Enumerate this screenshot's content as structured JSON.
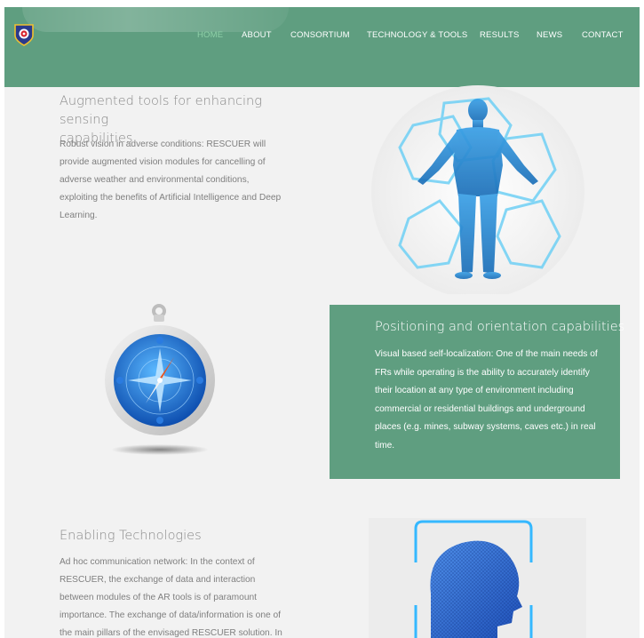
{
  "nav": {
    "items": [
      {
        "label": "HOME",
        "active": true
      },
      {
        "label": "ABOUT",
        "active": false
      },
      {
        "label": "CONSORTIUM",
        "active": false
      },
      {
        "label": "TECHNOLOGY & TOOLS",
        "active": false
      },
      {
        "label": "RESULTS",
        "active": false
      },
      {
        "label": "NEWS",
        "active": false
      },
      {
        "label": "CONTACT",
        "active": false
      }
    ]
  },
  "sections": {
    "augmented": {
      "title_line1": "Augmented tools for enhancing sensing",
      "title_line2": "capabilities",
      "text_lines": [
        "Robust vision in adverse conditions: RESCUER will",
        "provide augmented vision modules for cancelling of",
        "adverse weather and environmental conditions,",
        "exploiting the benefits of Artificial Intelligence and Deep",
        "Learning."
      ]
    },
    "positioning": {
      "title": "Positioning and orientation capabilities",
      "text_lines": [
        "Visual based self-localization: One of the main needs of",
        "FRs while operating is the ability to accurately identify",
        "their location at any type of environment including",
        "commercial or residential buildings and underground",
        "places (e.g. mines, subway systems, caves etc.) in real",
        "time."
      ]
    },
    "enabling": {
      "title": "Enabling Technologies",
      "text_lines": [
        "Ad hoc communication network: In the context of",
        "RESCUER, the exchange of data and interaction",
        "between modules of the AR tools is of paramount",
        "importance. The exchange of data/information is one of",
        "the main pillars of the envisaged RESCUER solution. In"
      ]
    }
  },
  "colors": {
    "header": "#5f9e80",
    "active_nav": "#8fd1a8",
    "box": "#5f9e80"
  },
  "icons": {
    "logo": "shield-logo-icon",
    "body": "wireframe-human-body-icon",
    "compass": "compass-icon",
    "head": "wireframe-head-icon"
  }
}
